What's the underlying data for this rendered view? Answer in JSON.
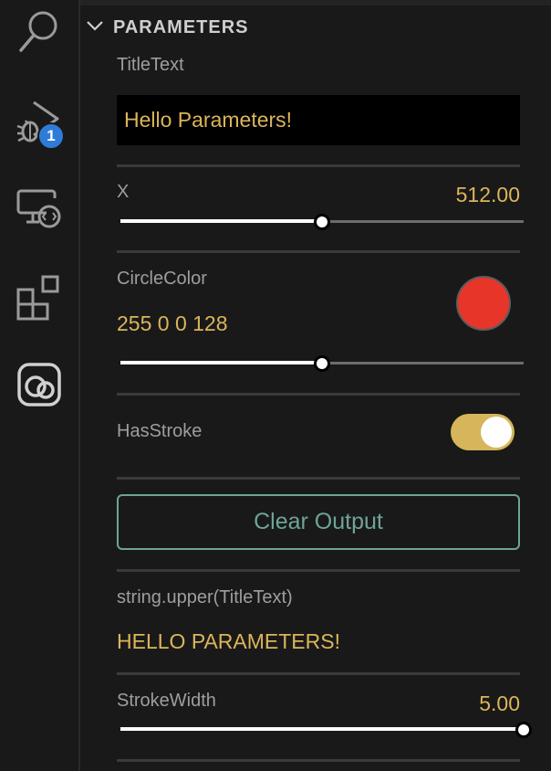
{
  "activity_bar": {
    "items": [
      {
        "icon": "search-icon"
      },
      {
        "icon": "run-debug-icon",
        "badge": "1"
      },
      {
        "icon": "remote-explorer-icon"
      },
      {
        "icon": "extensions-icon"
      },
      {
        "icon": "parameters-extension-icon"
      }
    ]
  },
  "panel": {
    "section_title": "PARAMETERS",
    "title_text": {
      "label": "TitleText",
      "value": "Hello Parameters!"
    },
    "x": {
      "label": "X",
      "value": "512.00",
      "slider_fraction": 0.5
    },
    "circle_color": {
      "label": "CircleColor",
      "value": "255 0 0 128",
      "swatch_color": "#e8352a",
      "slider_fraction": 0.5
    },
    "has_stroke": {
      "label": "HasStroke",
      "checked": true
    },
    "clear_output": {
      "label": "Clear Output"
    },
    "upper_expression": {
      "label": "string.upper(TitleText)",
      "value": "HELLO PARAMETERS!"
    },
    "stroke_width": {
      "label": "StrokeWidth",
      "value": "5.00",
      "slider_fraction": 1.0
    }
  },
  "colors": {
    "background": "#191919",
    "value_gold": "#dcb55a",
    "label_gray": "#9e9e9e",
    "badge_blue": "#2f7bd8",
    "toggle_on": "#d6b55b",
    "button_teal": "#6fa398"
  }
}
